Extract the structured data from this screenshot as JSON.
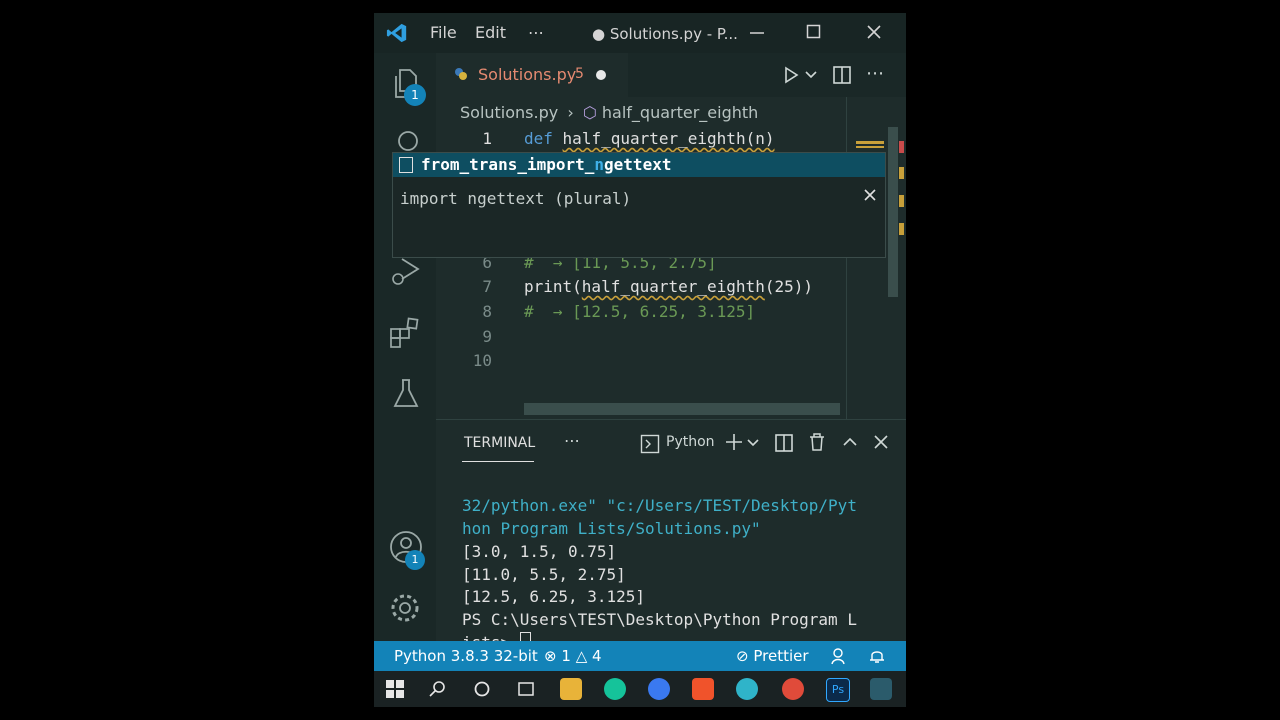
{
  "title_bar": {
    "menu": [
      "File",
      "Edit",
      "⋯"
    ],
    "window_title": "● Solutions.py - P..."
  },
  "activity_bar": {
    "explorer_badge": "1",
    "accounts_badge": "1"
  },
  "tab": {
    "filename": "Solutions.py",
    "problem_count": "5"
  },
  "breadcrumb": {
    "file": "Solutions.py",
    "symbol": "half_quarter_eighth"
  },
  "editor": {
    "lines": [
      {
        "num": "1",
        "keyword": "def",
        "text": "half_quarter_eighth(n)"
      },
      {
        "num": "6",
        "comment": "#  → [11, 5.5, 2.75]"
      },
      {
        "num": "7",
        "pre": "print(",
        "call": "half_quarter_eighth",
        "post": "(25))"
      },
      {
        "num": "8",
        "comment": "#  → [12.5, 6.25, 3.125]"
      },
      {
        "num": "9"
      },
      {
        "num": "10"
      }
    ]
  },
  "suggestion": {
    "item_prefix": "from_trans_import_",
    "item_match": "n",
    "item_suffix": "gettext",
    "detail": "import ngettext (plural)"
  },
  "terminal": {
    "tab_label": "TERMINAL",
    "more": "⋯",
    "shell": "Python",
    "lines": [
      "32/python.exe\" \"c:/Users/TEST/Desktop/Pyt",
      "hon Program Lists/Solutions.py\"",
      "[3.0, 1.5, 0.75]",
      "[11.0, 5.5, 2.75]",
      "[12.5, 6.25, 3.125]",
      "PS C:\\Users\\TEST\\Desktop\\Python Program L",
      "ists> "
    ]
  },
  "status_bar": {
    "interpreter": "Python 3.8.3 32-bit",
    "errors": "1",
    "warnings": "4",
    "formatter": "Prettier"
  },
  "taskbar": {
    "apps": [
      "windows-start",
      "search",
      "cortana",
      "task-view",
      "file-explorer",
      "grammarly",
      "app-c",
      "brave",
      "edge",
      "chrome",
      "photoshop",
      "python-app"
    ]
  },
  "colors": {
    "accent": "#1383b8",
    "tab_modified": "#e58a71",
    "comment": "#6a9955",
    "keyword": "#569cd6"
  }
}
